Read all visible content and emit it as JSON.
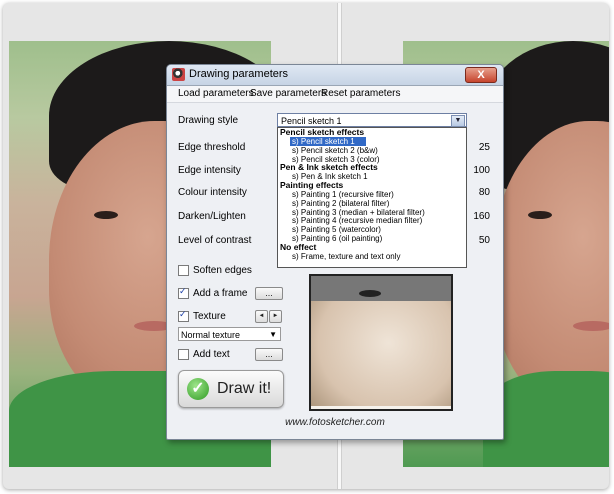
{
  "window": {
    "title": "Drawing parameters",
    "close_label": "X"
  },
  "menu": [
    "Load parameters",
    "Save parameters",
    "Reset parameters"
  ],
  "drawing_style": {
    "label": "Drawing style",
    "selected": "Pencil sketch 1",
    "options": [
      {
        "text": "Pencil sketch effects",
        "kind": "header"
      },
      {
        "text": "s) Pencil sketch 1",
        "kind": "selected"
      },
      {
        "text": "s) Pencil sketch 2 (b&w)",
        "kind": "item"
      },
      {
        "text": "s) Pencil sketch 3 (color)",
        "kind": "item"
      },
      {
        "text": "Pen & Ink sketch effects",
        "kind": "header"
      },
      {
        "text": "s) Pen & Ink sketch 1",
        "kind": "item"
      },
      {
        "text": "Painting effects",
        "kind": "header"
      },
      {
        "text": "s) Painting 1 (recursive filter)",
        "kind": "item"
      },
      {
        "text": "s) Painting 2 (bilateral filter)",
        "kind": "item"
      },
      {
        "text": "s) Painting 3 (median + bilateral filter)",
        "kind": "item"
      },
      {
        "text": "s) Painting 4 (recursive median filter)",
        "kind": "item"
      },
      {
        "text": "s) Painting 5 (watercolor)",
        "kind": "item"
      },
      {
        "text": "s) Painting 6 (oil painting)",
        "kind": "item"
      },
      {
        "text": "No effect",
        "kind": "header"
      },
      {
        "text": "s) Frame, texture and text only",
        "kind": "item"
      }
    ]
  },
  "params": [
    {
      "label": "Edge threshold",
      "value": "25"
    },
    {
      "label": "Edge intensity",
      "value": "100"
    },
    {
      "label": "Colour intensity",
      "value": "80"
    },
    {
      "label": "Darken/Lighten",
      "value": "160"
    },
    {
      "label": "Level of contrast",
      "value": "50"
    }
  ],
  "options": {
    "soften_edges": {
      "label": "Soften edges",
      "checked": false
    },
    "add_frame": {
      "label": "Add a frame",
      "checked": true,
      "button": "..."
    },
    "texture": {
      "label": "Texture",
      "checked": true,
      "prev": "◄",
      "next": "►",
      "selected": "Normal texture"
    },
    "add_text": {
      "label": "Add text",
      "checked": false,
      "button": "..."
    }
  },
  "draw_button": {
    "label": "Draw it!",
    "icon": "check-icon"
  },
  "footer_url": "www.fotosketcher.com"
}
